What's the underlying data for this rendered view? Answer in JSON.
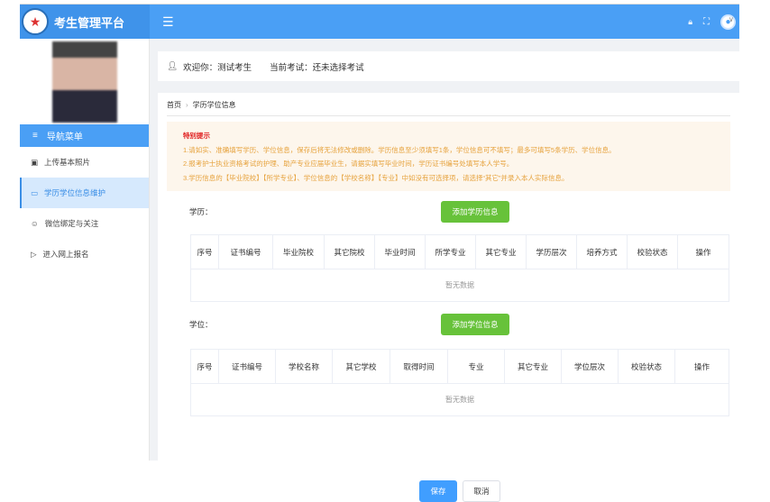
{
  "header": {
    "app_title": "考生管理平台",
    "icons": [
      "lock-icon",
      "fullscreen-icon",
      "user-avatar-icon",
      "chevron-down-icon"
    ],
    "color": "#4a9ff5"
  },
  "sidebar": {
    "nav_title": "导航菜单",
    "items": [
      {
        "label": "上传基本照片",
        "icon": "image-icon"
      },
      {
        "label": "学历学位信息维护",
        "icon": "book-icon",
        "active": true
      },
      {
        "label": "微信绑定与关注",
        "icon": "wechat-icon"
      },
      {
        "label": "进入网上报名",
        "icon": "send-icon"
      }
    ]
  },
  "welcome": {
    "greeting": "欢迎你：测试考生",
    "exam_label": "当前考试：",
    "exam_value": "还未选择考试"
  },
  "breadcrumb": {
    "home": "首页",
    "current": "学历学位信息"
  },
  "notice": {
    "title": "特别提示",
    "lines": [
      "1.请如实、准确填写学历、学位信息，保存后将无法修改或删除。学历信息至少须填写1条，学位信息可不填写；最多可填写5条学历、学位信息。",
      "2.报考护士执业资格考试的护理、助产专业应届毕业生，请据实填写毕业时间，学历证书编号处填写本人学号。",
      "3.学历信息的【毕业院校】【所学专业】、学位信息的【学校名称】【专业】中如没有可选择项，请选择“其它”并录入本人实际信息。"
    ]
  },
  "education": {
    "label": "学历：",
    "add_button": "添加学历信息",
    "columns": [
      "序号",
      "证书编号",
      "毕业院校",
      "其它院校",
      "毕业时间",
      "所学专业",
      "其它专业",
      "学历层次",
      "培养方式",
      "校验状态",
      "操作"
    ],
    "empty": "暂无数据"
  },
  "degree": {
    "label": "学位：",
    "add_button": "添加学位信息",
    "columns": [
      "序号",
      "证书编号",
      "学校名称",
      "其它学校",
      "取得时间",
      "专业",
      "其它专业",
      "学位层次",
      "校验状态",
      "操作"
    ],
    "empty": "暂无数据"
  },
  "actions": {
    "save": "保存",
    "cancel": "取消"
  }
}
